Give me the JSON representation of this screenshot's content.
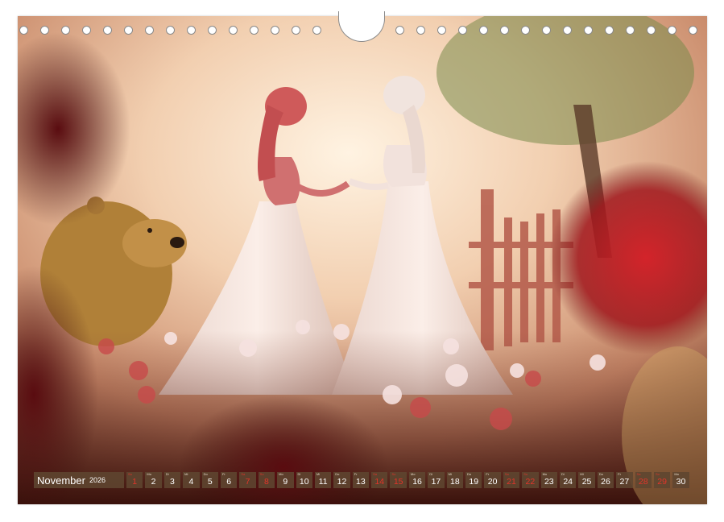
{
  "calendar": {
    "month": "November",
    "year": "2026",
    "days": [
      {
        "num": "1",
        "dow": "So",
        "weekend": true
      },
      {
        "num": "2",
        "dow": "Mo",
        "weekend": false
      },
      {
        "num": "3",
        "dow": "Di",
        "weekend": false
      },
      {
        "num": "4",
        "dow": "Mi",
        "weekend": false
      },
      {
        "num": "5",
        "dow": "Do",
        "weekend": false
      },
      {
        "num": "6",
        "dow": "Fr",
        "weekend": false
      },
      {
        "num": "7",
        "dow": "Sa",
        "weekend": true
      },
      {
        "num": "8",
        "dow": "So",
        "weekend": true
      },
      {
        "num": "9",
        "dow": "Mo",
        "weekend": false
      },
      {
        "num": "10",
        "dow": "Di",
        "weekend": false
      },
      {
        "num": "11",
        "dow": "Mi",
        "weekend": false
      },
      {
        "num": "12",
        "dow": "Do",
        "weekend": false
      },
      {
        "num": "13",
        "dow": "Fr",
        "weekend": false
      },
      {
        "num": "14",
        "dow": "Sa",
        "weekend": true
      },
      {
        "num": "15",
        "dow": "So",
        "weekend": true
      },
      {
        "num": "16",
        "dow": "Mo",
        "weekend": false
      },
      {
        "num": "17",
        "dow": "Di",
        "weekend": false
      },
      {
        "num": "18",
        "dow": "Mi",
        "weekend": false
      },
      {
        "num": "19",
        "dow": "Do",
        "weekend": false
      },
      {
        "num": "20",
        "dow": "Fr",
        "weekend": false
      },
      {
        "num": "21",
        "dow": "Sa",
        "weekend": true
      },
      {
        "num": "22",
        "dow": "So",
        "weekend": true
      },
      {
        "num": "23",
        "dow": "Mo",
        "weekend": false
      },
      {
        "num": "24",
        "dow": "Di",
        "weekend": false
      },
      {
        "num": "25",
        "dow": "Mi",
        "weekend": false
      },
      {
        "num": "26",
        "dow": "Do",
        "weekend": false
      },
      {
        "num": "27",
        "dow": "Fr",
        "weekend": false
      },
      {
        "num": "28",
        "dow": "Sa",
        "weekend": true
      },
      {
        "num": "29",
        "dow": "So",
        "weekend": true
      },
      {
        "num": "30",
        "dow": "Mo",
        "weekend": false
      }
    ]
  },
  "colors": {
    "bar": "#5f4630",
    "weekend": "#e2352a",
    "text": "#ffffff"
  },
  "photo": {
    "subject": "two-princess-figurines-in-rose-garden-with-bear"
  }
}
